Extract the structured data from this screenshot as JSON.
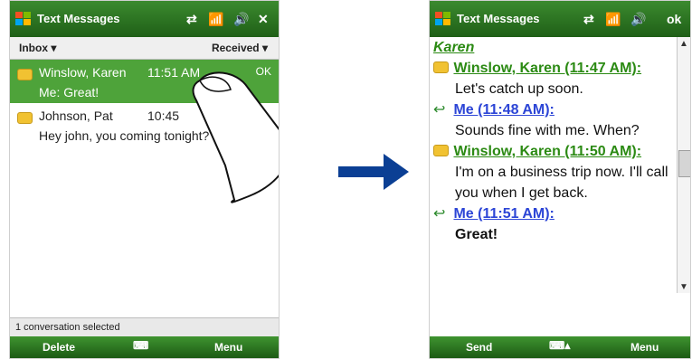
{
  "left": {
    "title": "Text Messages",
    "ok_label": "OK",
    "folder": "Inbox",
    "sort": "Received",
    "messages": [
      {
        "name": "Winslow, Karen",
        "time": "11:51 AM",
        "preview": "Me: Great!",
        "selected": true
      },
      {
        "name": "Johnson, Pat",
        "time": "10:45",
        "preview": "Hey john, you coming tonight?",
        "selected": false
      }
    ],
    "status": "1 conversation selected",
    "menu_left": "Delete",
    "menu_right": "Menu"
  },
  "right": {
    "title": "Text Messages",
    "ok_label": "ok",
    "contact": "Karen",
    "thread": [
      {
        "sender": "Winslow, Karen (11:47 AM):",
        "text": "Let's catch up soon.",
        "type": "incoming"
      },
      {
        "sender": "Me (11:48 AM):",
        "text": "Sounds fine with me. When?",
        "type": "outgoing"
      },
      {
        "sender": "Winslow, Karen (11:50 AM):",
        "text": "I'm on a business trip now. I'll call you when I get back.",
        "type": "incoming"
      },
      {
        "sender": "Me (11:51 AM):",
        "text": "Great!",
        "type": "outgoing"
      }
    ],
    "menu_left": "Send",
    "menu_right": "Menu"
  },
  "colors": {
    "green_dark": "#1f5f17",
    "green_light": "#3b8a2e",
    "selected_row": "#4ea33a",
    "incoming_sender": "#2b8a13",
    "outgoing_sender": "#2c45d6",
    "arrow": "#0b3f94"
  }
}
